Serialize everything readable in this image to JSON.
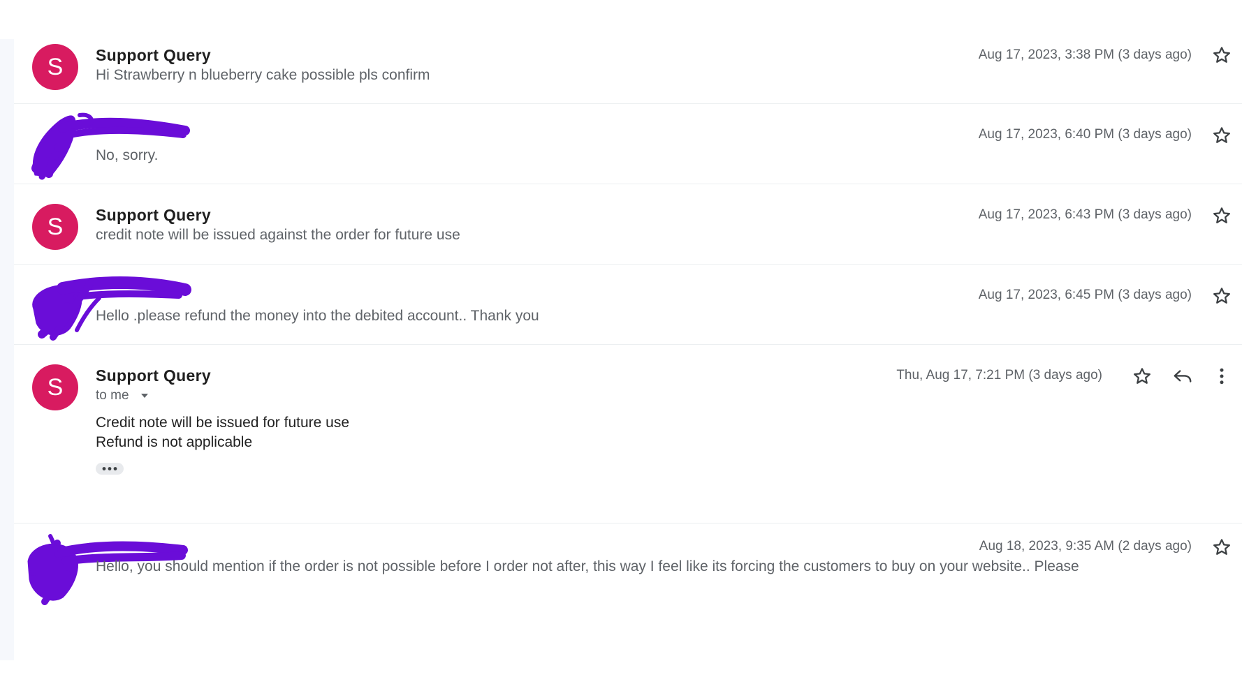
{
  "messages": [
    {
      "sender": "Support Query",
      "avatar_letter": "S",
      "snippet": "Hi Strawberry n blueberry cake possible pls confirm",
      "date": "Aug 17, 2023, 3:38 PM (3 days ago)"
    },
    {
      "sender": "",
      "snippet": "No, sorry.",
      "date": "Aug 17, 2023, 6:40 PM (3 days ago)"
    },
    {
      "sender": "Support Query",
      "avatar_letter": "S",
      "snippet": "credit note will be issued against the order for future use",
      "date": "Aug 17, 2023, 6:43 PM (3 days ago)"
    },
    {
      "sender": "",
      "snippet": "Hello .please refund the money into the debited account.. Thank you",
      "date": "Aug 17, 2023, 6:45 PM (3 days ago)"
    },
    {
      "sender": "Support Query",
      "avatar_letter": "S",
      "recipient": "to me",
      "body": [
        "Credit note will be issued for future use",
        "Refund is not applicable"
      ],
      "date": "Thu, Aug 17, 7:21 PM (3 days ago)"
    },
    {
      "sender": "",
      "snippet": "Hello, you should mention if the order is not possible before I order not after, this way I feel like its forcing the customers to buy on your website.. Please",
      "date": "Aug 18, 2023, 9:35 AM (2 days ago)"
    }
  ],
  "icons": {
    "star": "star-outline-icon",
    "reply": "reply-icon",
    "more": "more-vert-icon",
    "caret": "caret-down-icon",
    "ellipsis": "show-trimmed-content-icon"
  },
  "colors": {
    "avatar": "#d81b60",
    "redaction": "#6a0dd8",
    "secondary_text": "#5f6368"
  }
}
